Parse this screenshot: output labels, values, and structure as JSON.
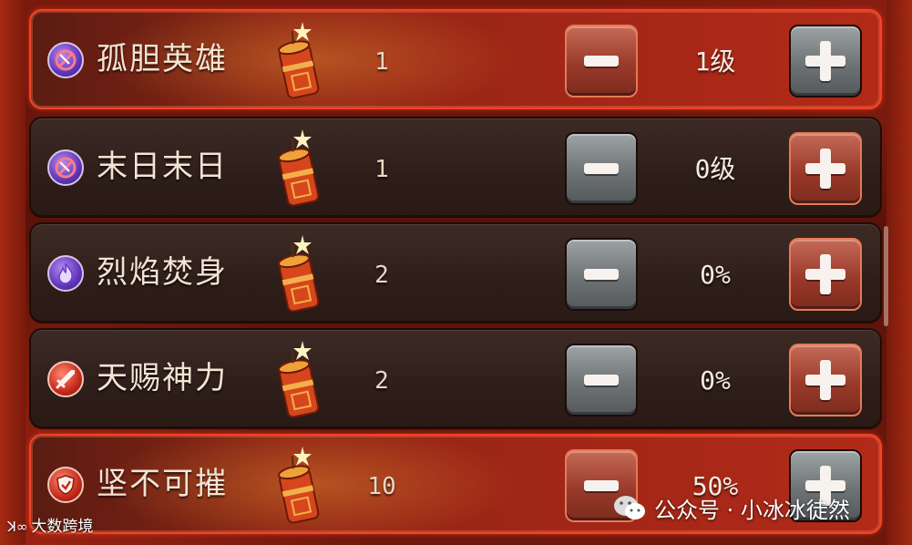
{
  "skills": [
    {
      "name": "孤胆英雄",
      "icon": "no-weapon-icon",
      "icon_color": "purple",
      "cost": "1",
      "level": "1级",
      "highlighted": true,
      "minus_style": "red",
      "plus_style": "gray"
    },
    {
      "name": "末日末日",
      "icon": "no-weapon-icon",
      "icon_color": "purple",
      "cost": "1",
      "level": "0级",
      "highlighted": false,
      "minus_style": "gray",
      "plus_style": "red"
    },
    {
      "name": "烈焰焚身",
      "icon": "flame-icon",
      "icon_color": "purple",
      "cost": "2",
      "level": "0%",
      "highlighted": false,
      "minus_style": "gray",
      "plus_style": "red"
    },
    {
      "name": "天赐神力",
      "icon": "sword-icon",
      "icon_color": "red",
      "cost": "2",
      "level": "0%",
      "highlighted": false,
      "minus_style": "gray",
      "plus_style": "red"
    },
    {
      "name": "坚不可摧",
      "icon": "shield-icon",
      "icon_color": "red",
      "cost": "10",
      "level": "50%",
      "highlighted": true,
      "minus_style": "red",
      "plus_style": "gray"
    }
  ],
  "cost_icon": "firecracker-icon",
  "watermark_left": "大数跨境",
  "watermark_right": "公众号 · 小冰冰徒然",
  "colors": {
    "highlight_border": "#f0442a",
    "row_dark": "#2e1e1a",
    "button_red": "#9a3a2a",
    "button_gray": "#6e7376"
  }
}
